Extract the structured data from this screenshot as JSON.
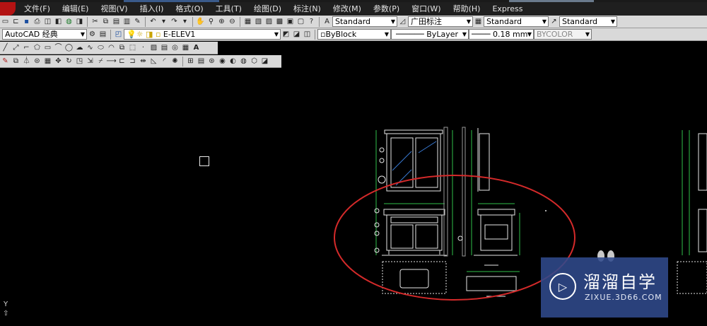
{
  "menu": [
    "文件(F)",
    "编辑(E)",
    "视图(V)",
    "插入(I)",
    "格式(O)",
    "工具(T)",
    "绘图(D)",
    "标注(N)",
    "修改(M)",
    "参数(P)",
    "窗口(W)",
    "帮助(H)",
    "Express"
  ],
  "styles": {
    "text_style": "Standard",
    "dim_style": "广田标注",
    "table_style": "Standard",
    "multileader_style": "Standard"
  },
  "workspace": "AutoCAD 经典",
  "layer": "E-ELEV1",
  "properties": {
    "color": "ByBlock",
    "linetype": "ByLayer",
    "lineweight": "0.18 mm",
    "plot_style": "BYCOLOR"
  },
  "draw_text_button": "A",
  "ucs": {
    "y_label": "Y"
  },
  "watermark": {
    "name": "溜溜自学",
    "url": "ZIXUE.3D66.COM"
  },
  "colors": {
    "highlight_circle": "#d42a2a",
    "accent": "#2f4a8c"
  }
}
